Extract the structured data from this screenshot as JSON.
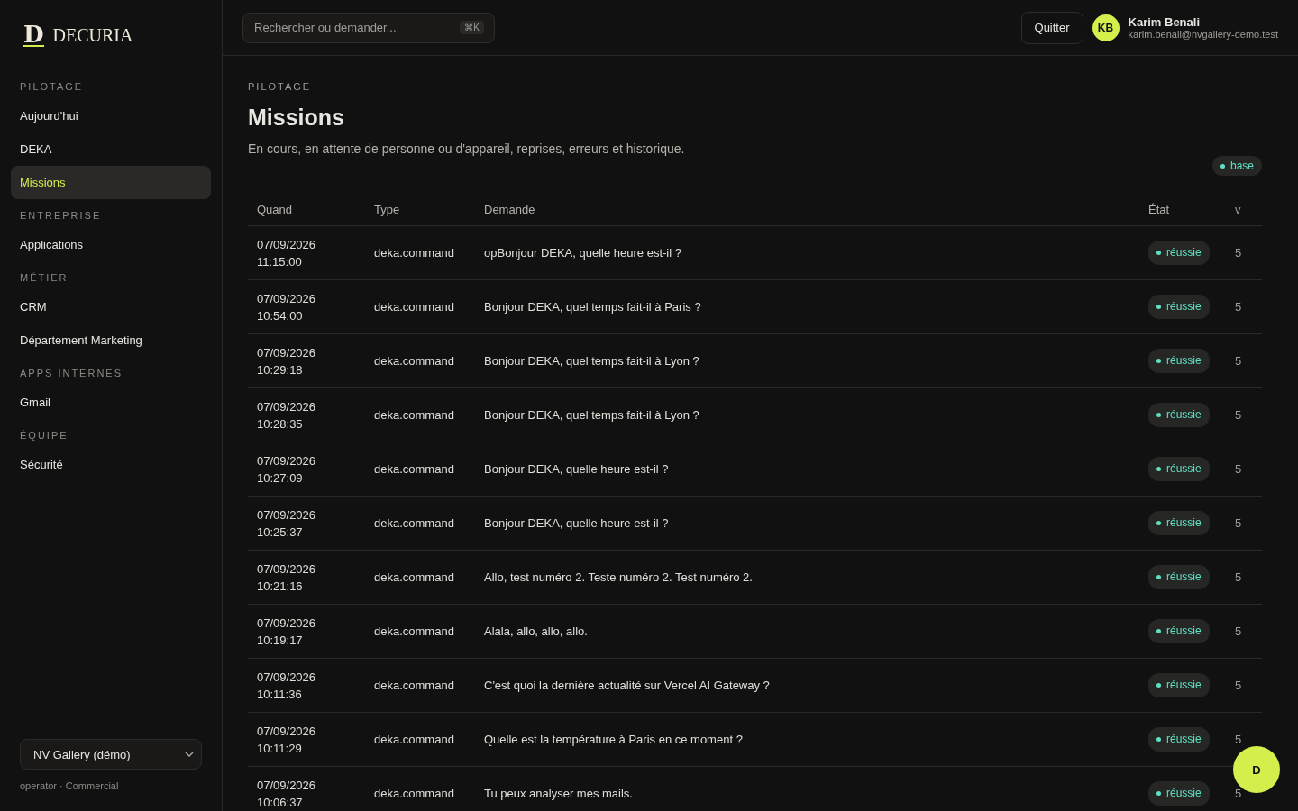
{
  "brand": {
    "mark": "D",
    "name": "DECURIA"
  },
  "sidebar": {
    "sections": [
      {
        "title": "PILOTAGE",
        "items": [
          {
            "label": "Aujourd'hui",
            "selected": false
          },
          {
            "label": "DEKA",
            "selected": false
          },
          {
            "label": "Missions",
            "selected": true
          }
        ]
      },
      {
        "title": "ENTREPRISE",
        "items": [
          {
            "label": "Applications",
            "selected": false
          }
        ]
      },
      {
        "title": "MÉTIER",
        "items": [
          {
            "label": "CRM",
            "selected": false
          },
          {
            "label": "Département Marketing",
            "selected": false
          }
        ]
      },
      {
        "title": "APPS INTERNES",
        "items": [
          {
            "label": "Gmail",
            "selected": false
          }
        ]
      },
      {
        "title": "ÉQUIPE",
        "items": [
          {
            "label": "Sécurité",
            "selected": false
          }
        ]
      }
    ],
    "workspace": {
      "value": "NV Gallery (démo)"
    },
    "role": "operator · Commercial"
  },
  "search": {
    "placeholder": "Rechercher ou demander...",
    "shortcut": "⌘K"
  },
  "header": {
    "quit": "Quitter",
    "user": {
      "initials": "KB",
      "name": "Karim Benali",
      "email": "karim.benali@nvgallery-demo.test"
    }
  },
  "page": {
    "eyebrow": "PILOTAGE",
    "title": "Missions",
    "description": "En cours, en attente de personne ou d'appareil, reprises, erreurs et historique.",
    "tag": "base"
  },
  "table": {
    "columns": [
      "Quand",
      "Type",
      "Demande",
      "État",
      "v"
    ],
    "rows": [
      {
        "date": "07/09/2026",
        "time": "11:15:00",
        "type": "deka.command",
        "request": "opBonjour DEKA, quelle heure est-il ?",
        "status": "réussie",
        "v": "5"
      },
      {
        "date": "07/09/2026",
        "time": "10:54:00",
        "type": "deka.command",
        "request": "Bonjour DEKA, quel temps fait-il à Paris ?",
        "status": "réussie",
        "v": "5"
      },
      {
        "date": "07/09/2026",
        "time": "10:29:18",
        "type": "deka.command",
        "request": "Bonjour DEKA, quel temps fait-il à Lyon ?",
        "status": "réussie",
        "v": "5"
      },
      {
        "date": "07/09/2026",
        "time": "10:28:35",
        "type": "deka.command",
        "request": "Bonjour DEKA, quel temps fait-il à Lyon ?",
        "status": "réussie",
        "v": "5"
      },
      {
        "date": "07/09/2026",
        "time": "10:27:09",
        "type": "deka.command",
        "request": "Bonjour DEKA, quelle heure est-il ?",
        "status": "réussie",
        "v": "5"
      },
      {
        "date": "07/09/2026",
        "time": "10:25:37",
        "type": "deka.command",
        "request": "Bonjour DEKA, quelle heure est-il ?",
        "status": "réussie",
        "v": "5"
      },
      {
        "date": "07/09/2026",
        "time": "10:21:16",
        "type": "deka.command",
        "request": "Allo, test numéro 2. Teste numéro 2. Test numéro 2.",
        "status": "réussie",
        "v": "5"
      },
      {
        "date": "07/09/2026",
        "time": "10:19:17",
        "type": "deka.command",
        "request": "Alala, allo, allo, allo.",
        "status": "réussie",
        "v": "5"
      },
      {
        "date": "07/09/2026",
        "time": "10:11:36",
        "type": "deka.command",
        "request": "C'est quoi la dernière actualité sur Vercel AI Gateway ?",
        "status": "réussie",
        "v": "5"
      },
      {
        "date": "07/09/2026",
        "time": "10:11:29",
        "type": "deka.command",
        "request": "Quelle est la température à Paris en ce moment ?",
        "status": "réussie",
        "v": "5"
      },
      {
        "date": "07/09/2026",
        "time": "10:06:37",
        "type": "deka.command",
        "request": "Tu peux analyser mes mails.",
        "status": "réussie",
        "v": "5"
      }
    ]
  },
  "fab": {
    "label": "D"
  }
}
